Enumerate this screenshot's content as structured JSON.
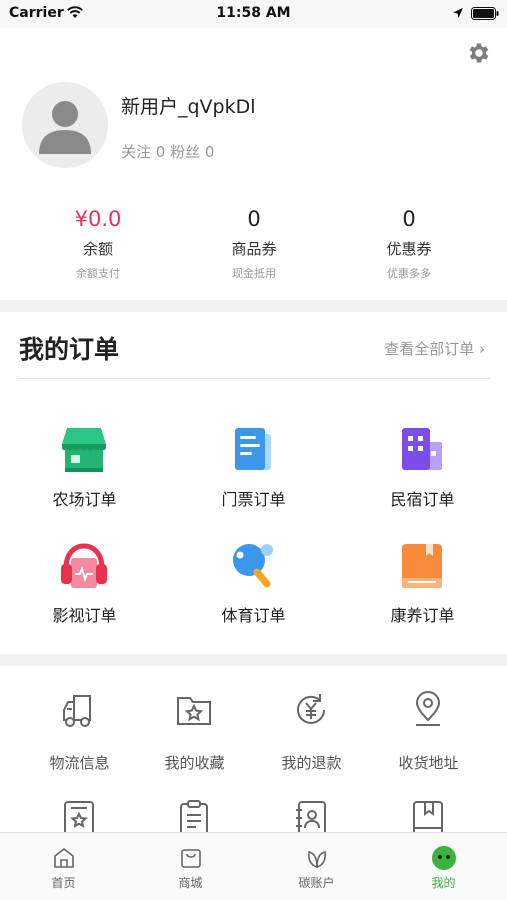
{
  "status_bar": {
    "carrier": "Carrier",
    "time": "11:58 AM"
  },
  "profile": {
    "username": "新用户_qVpkDl",
    "follow_text": "关注 0 粉丝 0",
    "stats": [
      {
        "value": "¥0.0",
        "name": "余额",
        "sub": "余额支付",
        "value_color": "#e8325a"
      },
      {
        "value": "0",
        "name": "商品券",
        "sub": "现金抵用"
      },
      {
        "value": "0",
        "name": "优惠券",
        "sub": "优惠多多"
      }
    ]
  },
  "orders": {
    "title": "我的订单",
    "view_all": "查看全部订单 ›",
    "items": [
      {
        "label": "农场订单",
        "icon": "farm-icon"
      },
      {
        "label": "门票订单",
        "icon": "ticket-icon"
      },
      {
        "label": "民宿订单",
        "icon": "homestay-icon"
      },
      {
        "label": "影视订单",
        "icon": "movie-icon"
      },
      {
        "label": "体育订单",
        "icon": "sports-icon"
      },
      {
        "label": "康养订单",
        "icon": "wellness-icon"
      }
    ]
  },
  "services": {
    "items": [
      {
        "label": "物流信息",
        "icon": "truck-icon"
      },
      {
        "label": "我的收藏",
        "icon": "favorites-folder-icon"
      },
      {
        "label": "我的退款",
        "icon": "refund-icon"
      },
      {
        "label": "收货地址",
        "icon": "location-pin-icon"
      }
    ]
  },
  "tabbar": {
    "items": [
      {
        "label": "首页",
        "icon": "home-icon"
      },
      {
        "label": "商城",
        "icon": "shop-bag-icon"
      },
      {
        "label": "碳账户",
        "icon": "leaf-icon"
      },
      {
        "label": "我的",
        "icon": "smiley-icon",
        "active": true
      }
    ],
    "active_color": "#3cb43c"
  }
}
